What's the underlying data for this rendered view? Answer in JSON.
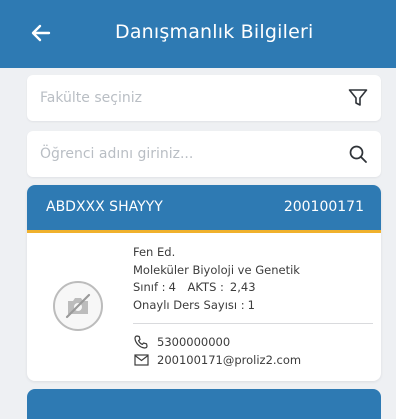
{
  "header": {
    "title": "Danışmanlık Bilgileri",
    "back_icon": "arrow-left-icon"
  },
  "filters": {
    "faculty_placeholder": "Fakülte seçiniz",
    "faculty_icon": "filter-icon",
    "student_placeholder": "Öğrenci adını giriniz...",
    "student_icon": "search-icon"
  },
  "student": {
    "name": "ABDXXX SHAYYY",
    "number": "200100171",
    "faculty": "Fen Ed.",
    "department": "Moleküler Biyoloji ve Genetik",
    "class_label": "Sınıf :",
    "class_value": "4",
    "akts_label": "AKTS :",
    "akts_value": "2,43",
    "approved_courses_label": "Onaylı Ders Sayısı :",
    "approved_courses_value": "1",
    "phone": "5300000000",
    "email": "200100171@proliz2.com",
    "avatar_icon": "no-photo-icon"
  },
  "colors": {
    "primary": "#2e7ab3",
    "accent": "#f0b12d",
    "background": "#eef0f3"
  }
}
